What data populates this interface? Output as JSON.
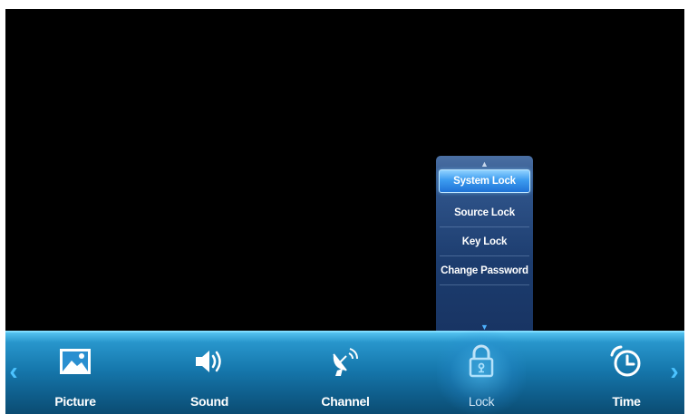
{
  "submenu": {
    "items": [
      {
        "label": "System Lock",
        "selected": true
      },
      {
        "label": "Source Lock",
        "selected": false
      },
      {
        "label": "Key Lock",
        "selected": false
      },
      {
        "label": "Change Password",
        "selected": false
      }
    ],
    "scroll_up_icon": "triangle-up-icon",
    "scroll_down_icon": "chevron-down-icon"
  },
  "menubar": {
    "left_arrow_icon": "chevron-left-icon",
    "right_arrow_icon": "chevron-right-icon",
    "active": "Lock",
    "items": [
      {
        "label": "Picture",
        "icon": "picture-icon"
      },
      {
        "label": "Sound",
        "icon": "speaker-icon"
      },
      {
        "label": "Channel",
        "icon": "satellite-dish-icon"
      },
      {
        "label": "Lock",
        "icon": "padlock-icon"
      },
      {
        "label": "Time",
        "icon": "clock-icon"
      }
    ]
  },
  "colors": {
    "background": "#000000",
    "menubar_accent": "#2896cc",
    "selection": "#3c9cf0",
    "arrow": "#4cc3ff"
  }
}
